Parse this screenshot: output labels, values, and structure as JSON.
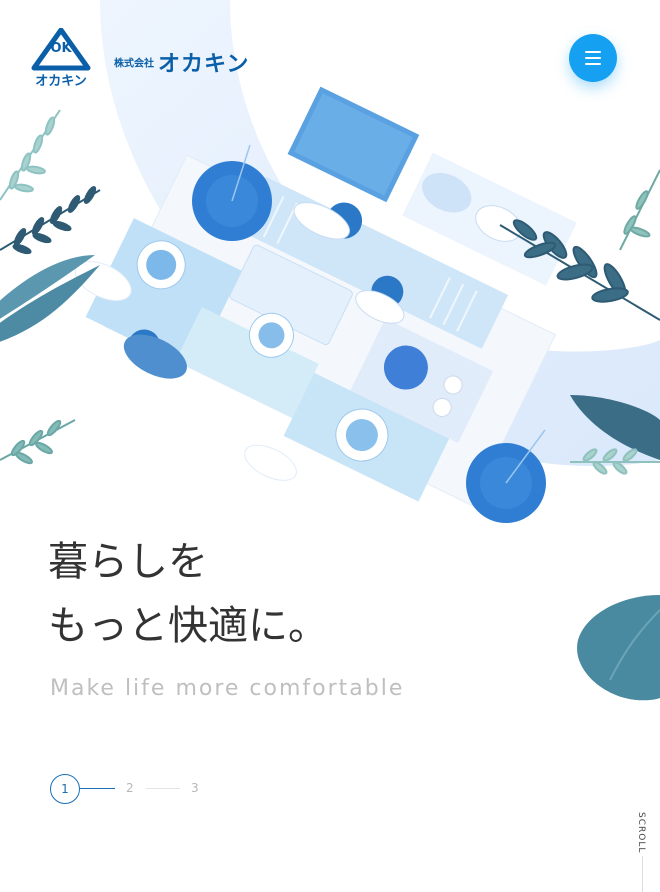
{
  "header": {
    "logo_mark_text": "OK",
    "logo_kana": "オカキン",
    "company_prefix": "株式会社",
    "company_name": "オカキン",
    "menu_icon": "hamburger-icon"
  },
  "hero": {
    "headline_line1": "暮らしを",
    "headline_line2": "もっと快適に。",
    "tagline": "Make life more comfortable"
  },
  "pager": {
    "pages": [
      "1",
      "2",
      "3"
    ],
    "active": "1"
  },
  "scroll_label": "SCROLL",
  "colors": {
    "brand": "#0a5fa8",
    "accent": "#16a0f2",
    "headline": "#333333",
    "tagline": "#bfbfbf"
  }
}
